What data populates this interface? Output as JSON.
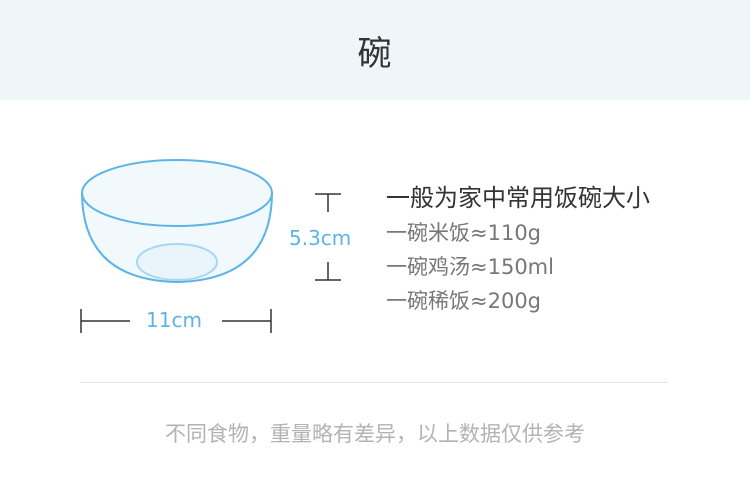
{
  "header": {
    "title": "碗"
  },
  "bowl": {
    "height_label": "5.3cm",
    "width_label": "11cm"
  },
  "info": {
    "heading": "一般为家中常用饭碗大小",
    "items": [
      "一碗米饭≈110g",
      "一碗鸡汤≈150ml",
      "一碗稀饭≈200g"
    ]
  },
  "footer": {
    "note": "不同食物，重量略有差异，以上数据仅供参考"
  },
  "colors": {
    "accent": "#5db4e6",
    "header_bg": "#eef6fa"
  }
}
